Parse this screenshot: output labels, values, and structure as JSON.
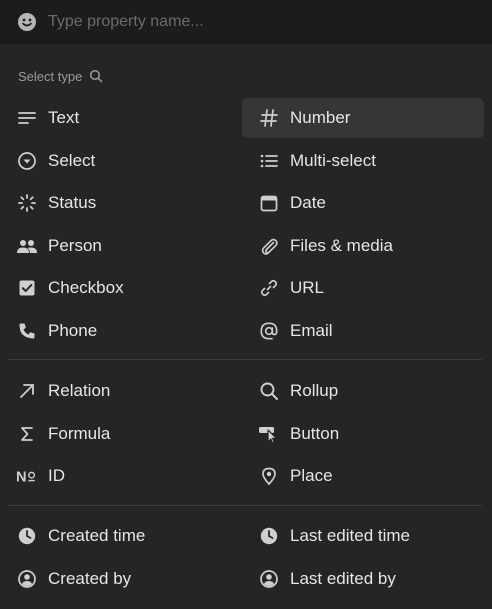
{
  "search": {
    "placeholder": "Type property name..."
  },
  "section": {
    "label": "Select type"
  },
  "group1": [
    {
      "label": "Text",
      "icon": "text-lines-icon"
    },
    {
      "label": "Number",
      "icon": "hash-icon"
    },
    {
      "label": "Select",
      "icon": "select-circle-icon"
    },
    {
      "label": "Multi-select",
      "icon": "list-icon"
    },
    {
      "label": "Status",
      "icon": "status-spinner-icon"
    },
    {
      "label": "Date",
      "icon": "calendar-icon"
    },
    {
      "label": "Person",
      "icon": "people-icon"
    },
    {
      "label": "Files & media",
      "icon": "paperclip-icon"
    },
    {
      "label": "Checkbox",
      "icon": "checkbox-icon"
    },
    {
      "label": "URL",
      "icon": "link-icon"
    },
    {
      "label": "Phone",
      "icon": "phone-icon"
    },
    {
      "label": "Email",
      "icon": "at-icon"
    }
  ],
  "group2": [
    {
      "label": "Relation",
      "icon": "arrow-up-right-icon"
    },
    {
      "label": "Rollup",
      "icon": "magnifier-icon"
    },
    {
      "label": "Formula",
      "icon": "sigma-icon"
    },
    {
      "label": "Button",
      "icon": "cursor-click-icon"
    },
    {
      "label": "ID",
      "icon": "numero-icon"
    },
    {
      "label": "Place",
      "icon": "map-pin-icon"
    }
  ],
  "group3": [
    {
      "label": "Created time",
      "icon": "clock-icon"
    },
    {
      "label": "Last edited time",
      "icon": "clock-icon"
    },
    {
      "label": "Created by",
      "icon": "user-circle-icon"
    },
    {
      "label": "Last edited by",
      "icon": "user-circle-icon"
    }
  ],
  "colors": {
    "background": "#252525",
    "search_bg": "#1c1c1c",
    "active_bg": "#363636",
    "text": "#e6e6e6",
    "muted": "#9b9b9b"
  }
}
